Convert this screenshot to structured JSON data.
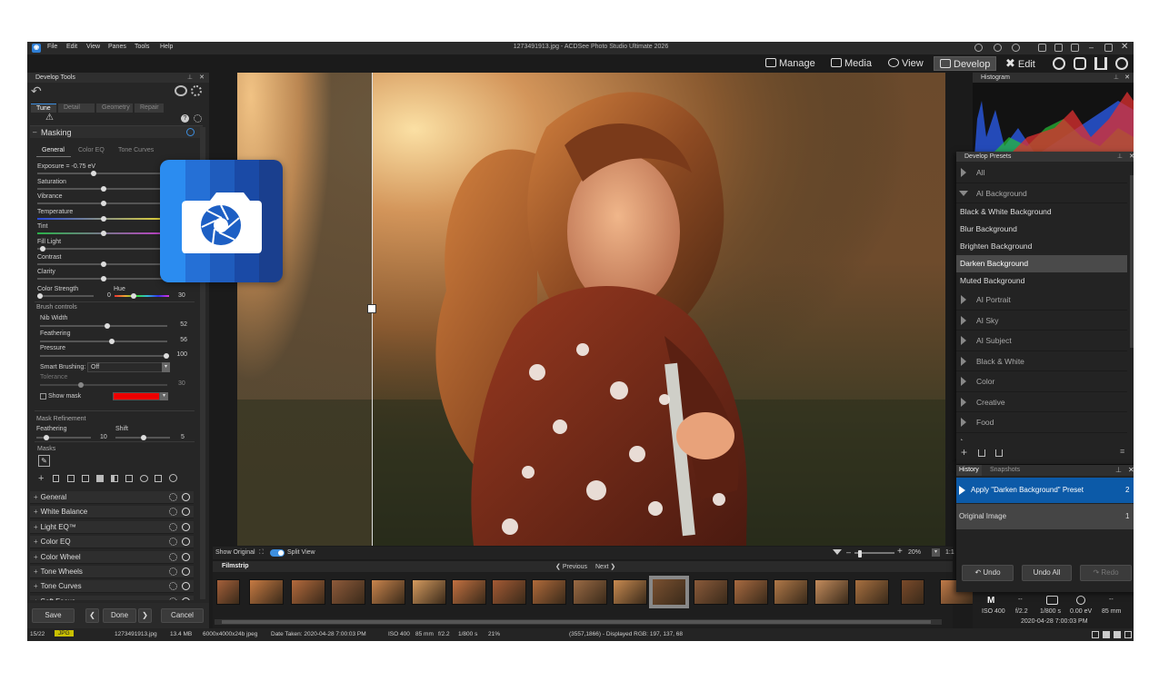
{
  "window": {
    "title": "1273491913.jpg - ACDSee Photo Studio Ultimate 2026",
    "app_icon": "acdsee-icon"
  },
  "menu": [
    "File",
    "Edit",
    "View",
    "Panes",
    "Tools",
    "Help"
  ],
  "modes": [
    {
      "label": "Manage",
      "icon": "grid-icon"
    },
    {
      "label": "Media",
      "icon": "media-icon"
    },
    {
      "label": "View",
      "icon": "eye-icon"
    },
    {
      "label": "Develop",
      "icon": "develop-icon",
      "active": true
    },
    {
      "label": "Edit",
      "icon": "edit-icon"
    }
  ],
  "develop_tools": {
    "title": "Develop Tools",
    "tabs": [
      "Tune",
      "Detail",
      "Geometry",
      "Repair"
    ],
    "masking": {
      "title": "Masking",
      "subtabs": [
        "General",
        "Color EQ",
        "Tone Curves"
      ],
      "sliders": [
        {
          "label": "Exposure = -0.75 eV",
          "pos": 0.42
        },
        {
          "label": "Saturation",
          "pos": 0.5
        },
        {
          "label": "Vibrance",
          "pos": 0.5
        },
        {
          "label": "Temperature",
          "pos": 0.5,
          "gradient": "temp"
        },
        {
          "label": "Tint",
          "pos": 0.5,
          "gradient": "tint"
        },
        {
          "label": "Fill Light",
          "pos": 0.02
        },
        {
          "label": "Contrast",
          "pos": 0.5
        },
        {
          "label": "Clarity",
          "pos": 0.5
        }
      ],
      "color_strength": {
        "label": "Color Strength",
        "hue_label": "Hue",
        "value": "0",
        "hue_value": "30"
      },
      "brush_controls": {
        "title": "Brush controls",
        "items": [
          {
            "label": "Nib Width",
            "value": "52",
            "pos": 0.52
          },
          {
            "label": "Feathering",
            "value": "56",
            "pos": 0.56
          },
          {
            "label": "Pressure",
            "value": "100",
            "pos": 1.0
          }
        ],
        "smart_brushing_label": "Smart Brushing:",
        "smart_brushing_value": "Off",
        "tolerance_label": "Tolerance",
        "tolerance_value": "30",
        "show_mask_label": "Show mask"
      },
      "mask_refinement": {
        "title": "Mask Refinement",
        "feathering_label": "Feathering",
        "feathering_value": "10",
        "shift_label": "Shift",
        "shift_value": "5"
      },
      "masks_label": "Masks"
    },
    "sections": [
      "General",
      "White Balance",
      "Light EQ™",
      "Color EQ",
      "Color Wheel",
      "Tone Wheels",
      "Tone Curves",
      "Soft Focus"
    ],
    "buttons": {
      "save": "Save",
      "done": "Done",
      "cancel": "Cancel"
    }
  },
  "view_bar": {
    "show_original": "Show Original",
    "split_view": "Split View",
    "zoom": "20%",
    "ratio": "1:1"
  },
  "filmstrip": {
    "title": "Filmstrip",
    "previous": "Previous",
    "next": "Next"
  },
  "histogram": {
    "title": "Histogram"
  },
  "presets": {
    "title": "Develop Presets",
    "items": [
      {
        "label": "All",
        "type": "cat"
      },
      {
        "label": "AI Background",
        "type": "cat",
        "open": true
      },
      {
        "label": "Black & White Background",
        "type": "item"
      },
      {
        "label": "Blur Background",
        "type": "item"
      },
      {
        "label": "Brighten Background",
        "type": "item"
      },
      {
        "label": "Darken Background",
        "type": "item",
        "selected": true
      },
      {
        "label": "Muted Background",
        "type": "item"
      },
      {
        "label": "AI Portrait",
        "type": "cat"
      },
      {
        "label": "AI Sky",
        "type": "cat"
      },
      {
        "label": "AI Subject",
        "type": "cat"
      },
      {
        "label": "Black & White",
        "type": "cat"
      },
      {
        "label": "Color",
        "type": "cat"
      },
      {
        "label": "Creative",
        "type": "cat"
      },
      {
        "label": "Food",
        "type": "cat"
      },
      {
        "label": "General",
        "type": "cat"
      }
    ]
  },
  "history": {
    "tabs": [
      "History",
      "Snapshots"
    ],
    "rows": [
      {
        "label": "Apply \"Darken Background\" Preset",
        "num": "2"
      },
      {
        "label": "Original Image",
        "num": "1"
      }
    ],
    "buttons": {
      "undo": "Undo",
      "undo_all": "Undo All",
      "redo": "Redo"
    }
  },
  "info": {
    "mode": "M",
    "iso": "ISO 400",
    "aperture": "f/2.2",
    "shutter": "1/800 s",
    "ev": "0.00 eV",
    "focal": "85 mm",
    "date": "2020-04-28 7:00:03 PM",
    "dash": "--"
  },
  "status": {
    "index": "15/22",
    "format": "JPG",
    "filename": "1273491913.jpg",
    "size": "13.4 MB",
    "dims": "6000x4000x24b jpeg",
    "taken": "Date Taken: 2020-04-28 7:00:03 PM",
    "iso": "ISO 400",
    "focal": "85 mm",
    "fstop": "f/2.2",
    "shutter": "1/800 s",
    "zoom": "21%",
    "pixel": "(3557,1866) - Displayed RGB: 197, 137, 68"
  }
}
